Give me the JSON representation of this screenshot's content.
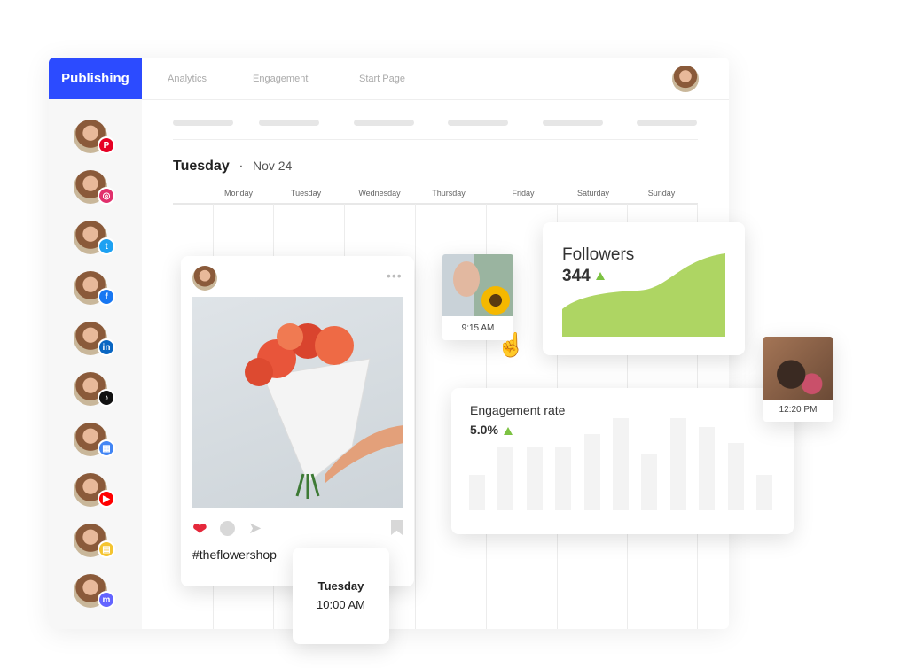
{
  "header": {
    "tabs": [
      {
        "label": "Publishing",
        "active": true
      },
      {
        "label": "Analytics"
      },
      {
        "label": "Engagement"
      },
      {
        "label": "Start Page"
      }
    ]
  },
  "sidebar": {
    "channels": [
      {
        "name": "pinterest",
        "color": "#e60023",
        "glyph": "P"
      },
      {
        "name": "instagram",
        "color": "#e1306c",
        "glyph": "◎"
      },
      {
        "name": "twitter",
        "color": "#1da1f2",
        "glyph": "t"
      },
      {
        "name": "facebook",
        "color": "#1877f2",
        "glyph": "f"
      },
      {
        "name": "linkedin",
        "color": "#0a66c2",
        "glyph": "in"
      },
      {
        "name": "tiktok",
        "color": "#111111",
        "glyph": "♪"
      },
      {
        "name": "google-business",
        "color": "#4285f4",
        "glyph": "▦"
      },
      {
        "name": "youtube",
        "color": "#ff0000",
        "glyph": "▶"
      },
      {
        "name": "start-page",
        "color": "#f4c430",
        "glyph": "▤"
      },
      {
        "name": "mastodon",
        "color": "#6364ff",
        "glyph": "m"
      }
    ]
  },
  "calendar": {
    "day": "Tuesday",
    "date": "Nov 24",
    "weekdays": [
      "Monday",
      "Tuesday",
      "Wednesday",
      "Thursday",
      "Friday",
      "Saturday",
      "Sunday"
    ]
  },
  "post": {
    "hashtag": "#theflowershop",
    "schedule_day": "Tuesday",
    "schedule_time": "10:00 AM"
  },
  "scheduled": [
    {
      "time": "9:15 AM"
    },
    {
      "time": "12:20 PM"
    }
  ],
  "followers": {
    "title": "Followers",
    "value": "344",
    "trend": "up"
  },
  "engagement": {
    "title": "Engagement rate",
    "value": "5.0%",
    "trend": "up"
  },
  "chart_data": [
    {
      "type": "area",
      "title": "Followers",
      "trend": "increasing",
      "color": "#aed563"
    },
    {
      "type": "bar",
      "title": "Engagement rate",
      "values": [
        38,
        68,
        68,
        68,
        83,
        100,
        62,
        100,
        90,
        73,
        38
      ],
      "color": "#f3f3f3"
    }
  ],
  "colors": {
    "accent": "#2c4bff",
    "trend_up": "#7cc242",
    "heart": "#e5283b"
  }
}
